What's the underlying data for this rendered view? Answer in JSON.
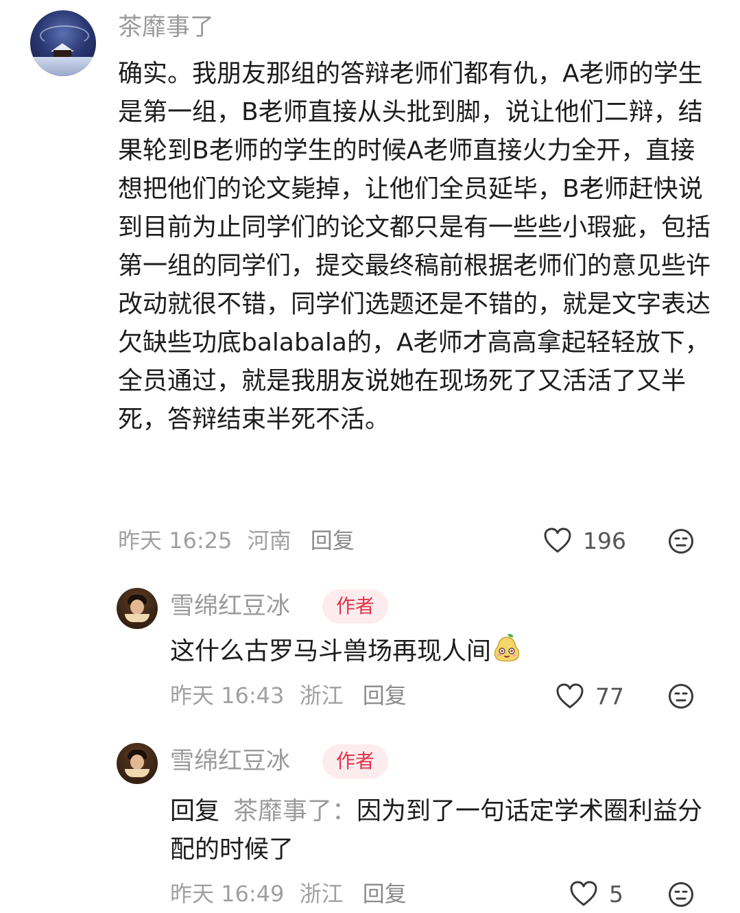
{
  "comments": [
    {
      "username": "茶靡事了",
      "text": "确实。我朋友那组的答辩老师们都有仇，A老师的学生是第一组，B老师直接从头批到脚，说让他们二辩，结果轮到B老师的学生的时候A老师直接火力全开，直接想把他们的论文毙掉，让他们全员延毕，B老师赶快说到目前为止同学们的论文都只是有一些些小瑕疵，包括第一组的同学们，提交最终稿前根据老师们的意见些许改动就很不错，同学们选题还是不错的，就是文字表达欠缺些功底balabala的，A老师才高高拿起轻轻放下，全员通过，就是我朋友说她在现场死了又活活了又半死，答辩结束半死不活。",
      "time": "昨天 16:25",
      "location": "河南",
      "reply_label": "回复",
      "likes": "196"
    },
    {
      "username": "雪绵红豆冰",
      "badge": "作者",
      "text": "这什么古罗马斗兽场再现人间",
      "emoji": "smiling-pear-emoji",
      "time": "昨天 16:43",
      "location": "浙江",
      "reply_label": "回复",
      "likes": "77"
    },
    {
      "username": "雪绵红豆冰",
      "badge": "作者",
      "reply_prefix": "回复",
      "reply_target": "茶靡事了：",
      "text": "因为到了一句话定学术圈利益分配的时候了",
      "time": "昨天 16:49",
      "location": "浙江",
      "reply_label": "回复",
      "likes": "5"
    }
  ],
  "icons": {
    "like": "heart-outline-icon",
    "dislike": "meh-face-icon"
  },
  "colors": {
    "text": "#1c1c1c",
    "meta": "#a0a0a0",
    "username": "#9a9a9a",
    "badge_text": "#e0344a",
    "badge_bg": "#fdecee"
  }
}
